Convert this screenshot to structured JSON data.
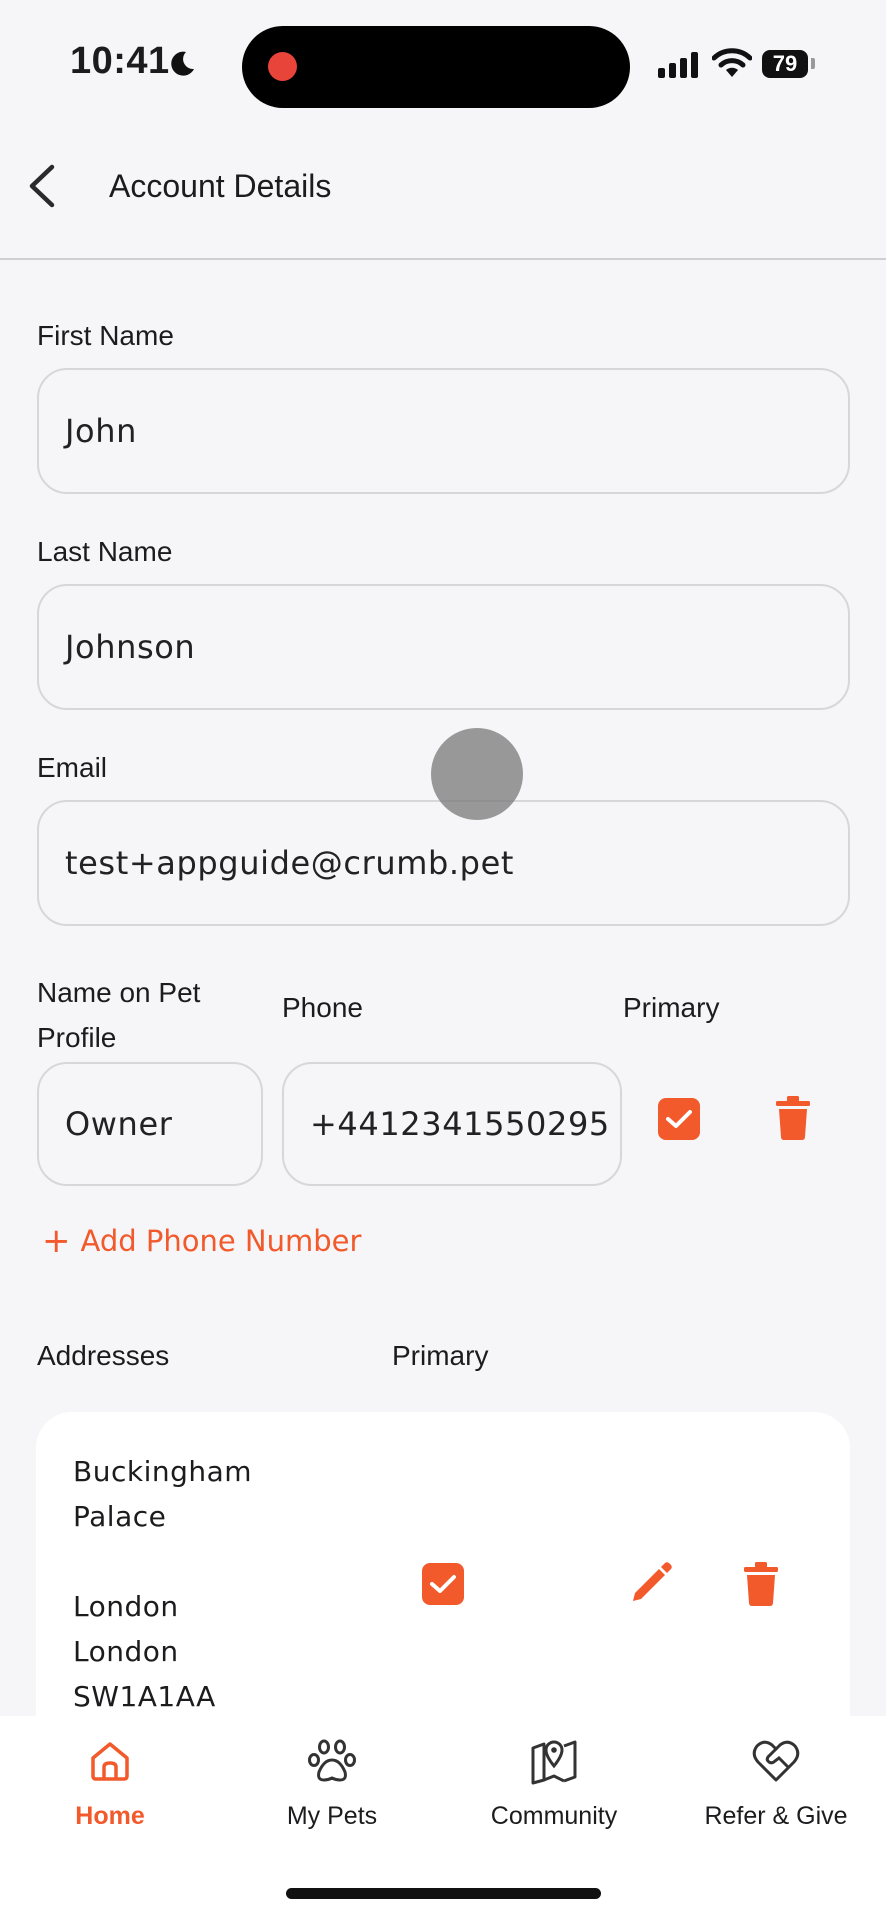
{
  "status_bar": {
    "time": "10:41",
    "battery": "79"
  },
  "header": {
    "title": "Account Details"
  },
  "form": {
    "first_name": {
      "label": "First Name",
      "value": "John"
    },
    "last_name": {
      "label": "Last Name",
      "value": "Johnson"
    },
    "email": {
      "label": "Email",
      "value": "test+appguide@crumb.pet"
    },
    "phone_section": {
      "name_label_line1": "Name on Pet",
      "name_label_line2": "Profile",
      "phone_label": "Phone",
      "primary_label": "Primary",
      "rows": [
        {
          "name": "Owner",
          "phone": "+4412341550295",
          "primary": true
        }
      ],
      "add_label": "Add Phone Number"
    },
    "addresses": {
      "label": "Addresses",
      "primary_label": "Primary",
      "items": [
        {
          "lines": [
            "Buckingham",
            "Palace",
            "",
            "London",
            "London",
            "SW1A1AA"
          ],
          "primary": true
        }
      ]
    }
  },
  "tab_bar": {
    "active": "home",
    "tabs": [
      {
        "id": "home",
        "label": "Home",
        "icon": "home-icon"
      },
      {
        "id": "my-pets",
        "label": "My Pets",
        "icon": "paw-icon"
      },
      {
        "id": "community",
        "label": "Community",
        "icon": "map-pin-icon"
      },
      {
        "id": "refer",
        "label": "Refer & Give",
        "icon": "heart-handshake-icon"
      }
    ]
  },
  "colors": {
    "accent": "#f2592b",
    "background": "#f6f5f8",
    "field_border": "#d8d6db"
  }
}
